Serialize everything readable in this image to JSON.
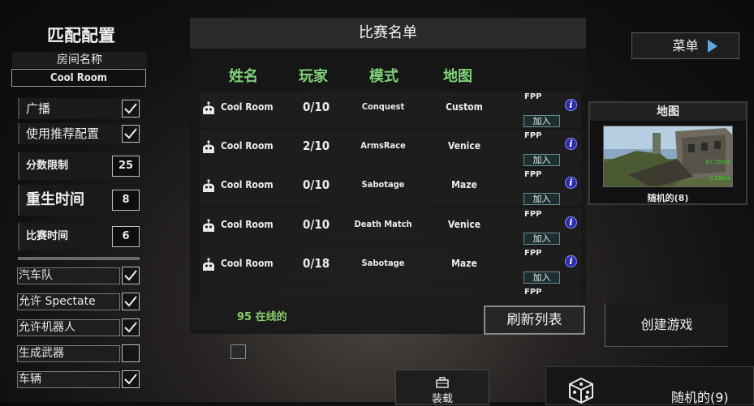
{
  "settings": {
    "title": "匹配配置",
    "room_name_label": "房间名称",
    "room_name_value": "Cool Room",
    "broadcast_label": "广播",
    "recommended_label": "使用推荐配置",
    "score_limit_label": "分数限制",
    "score_limit_value": "25",
    "respawn_label": "重生时间",
    "respawn_value": "8",
    "match_time_label": "比赛时间",
    "match_time_value": "6",
    "options": [
      {
        "label": "汽车队",
        "checked": true
      },
      {
        "label": "允许 Spectate",
        "checked": true
      },
      {
        "label": "允许机器人",
        "checked": true
      },
      {
        "label": "生成武器",
        "checked": false
      },
      {
        "label": "车辆",
        "checked": true
      }
    ]
  },
  "match_list": {
    "title": "比赛名单",
    "columns": [
      "姓名",
      "玩家",
      "模式",
      "地图"
    ],
    "rows": [
      {
        "name": "Cool Room",
        "players": "0/10",
        "mode": "Conquest",
        "map": "Custom",
        "tag": "FPP",
        "join": "加入"
      },
      {
        "name": "Cool Room",
        "players": "2/10",
        "mode": "ArmsRace",
        "map": "Venice",
        "tag": "FPP",
        "join": "加入"
      },
      {
        "name": "Cool Room",
        "players": "0/10",
        "mode": "Sabotage",
        "map": "Maze",
        "tag": "FPP",
        "join": "加入"
      },
      {
        "name": "Cool Room",
        "players": "0/10",
        "mode": "Death Match",
        "map": "Venice",
        "tag": "FPP",
        "join": "加入"
      },
      {
        "name": "Cool Room",
        "players": "0/18",
        "mode": "Sabotage",
        "map": "Maze",
        "tag": "FPP",
        "join": "加入"
      }
    ],
    "partial_tag": "FPP",
    "info_glyph": "i",
    "online_text": "95 在线的",
    "refresh_label": "刷新列表"
  },
  "create_label": "创建游戏",
  "menu_label": "菜单",
  "map_panel": {
    "title": "地图",
    "caption": "随机的(8)",
    "overlay_1": "67.35ms",
    "overlay_2": "0.28ms"
  },
  "equip_label": "装载",
  "random_label": "随机的(9)",
  "colors": {
    "accent_green": "#7fd27a",
    "info_blue": "#2a2cae",
    "menu_arrow": "#5aa8e6"
  }
}
